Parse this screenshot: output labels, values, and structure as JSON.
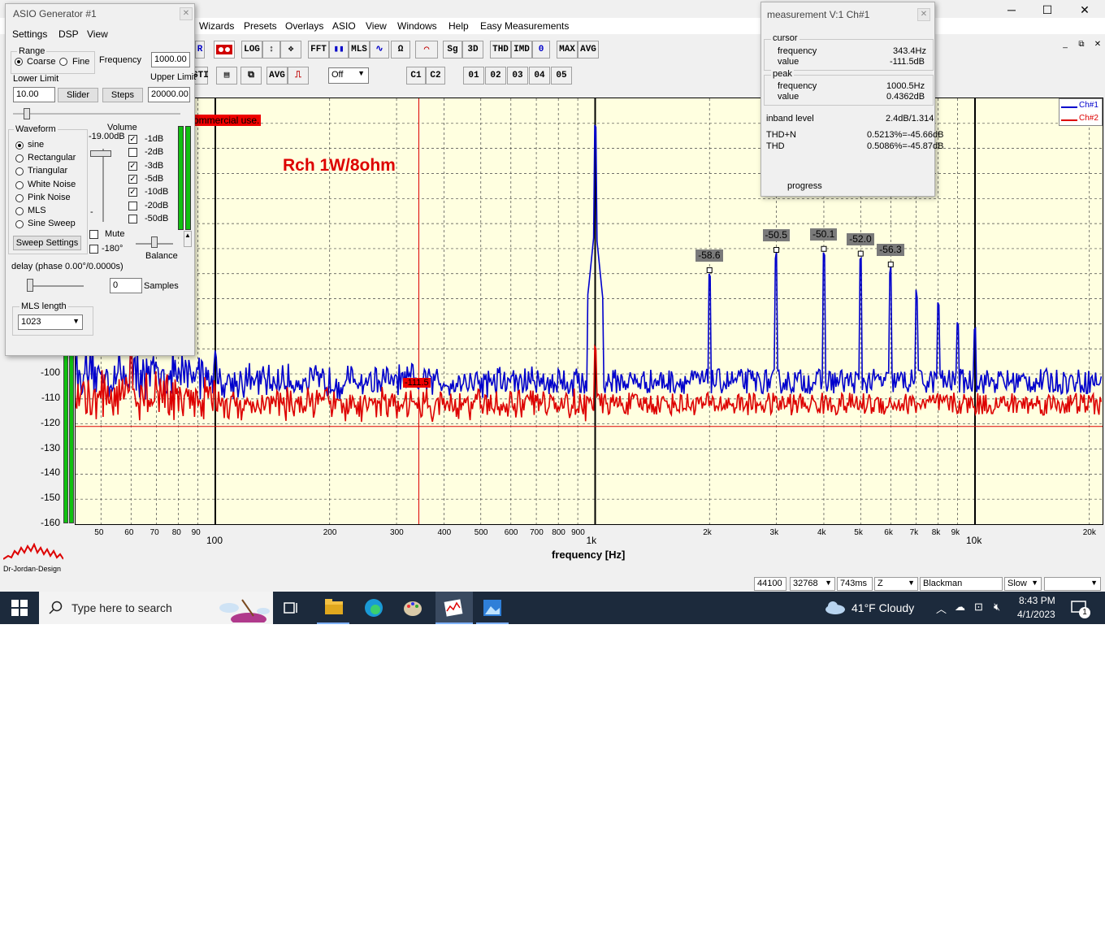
{
  "menu": [
    "Wizards",
    "Presets",
    "Overlays",
    "ASIO",
    "View",
    "Windows",
    "Help",
    "Easy Measurements"
  ],
  "window_controls": {
    "minimize": "─",
    "maximize": "☐",
    "close": "✕"
  },
  "toolbar": {
    "row1": [
      "R",
      "LOG",
      "↕",
      "✥",
      "FFT",
      "▮▮",
      "MLS",
      "∿",
      "Ω",
      "⌒",
      "Sg",
      "3D",
      "THD",
      "IMD",
      "0",
      "MAX",
      "AVG"
    ],
    "row2": [
      "STI",
      "▤",
      "⧉",
      "AVG",
      "⎍",
      "C1",
      "C2",
      "01",
      "02",
      "03",
      "04",
      "05"
    ],
    "dropdown_off": "Off"
  },
  "asio": {
    "title": "ASIO Generator #1",
    "menu": [
      "Settings",
      "DSP",
      "View"
    ],
    "range_label": "Range",
    "coarse": "Coarse",
    "fine": "Fine",
    "frequency_label": "Frequency",
    "frequency_value": "1000.00",
    "lower_limit_label": "Lower Limit",
    "lower_limit_value": "10.00",
    "upper_limit_label": "Upper Limit",
    "upper_limit_value": "20000.00",
    "slider_btn": "Slider",
    "steps_btn": "Steps",
    "waveform_label": "Waveform",
    "waveforms": [
      "sine",
      "Rectangular",
      "Triangular",
      "White Noise",
      "Pink Noise",
      "MLS",
      "Sine Sweep"
    ],
    "sweep_settings": "Sweep Settings",
    "volume_label": "Volume",
    "volume_value": "-19.00dB",
    "volume_steps": [
      "-1dB",
      "-2dB",
      "-3dB",
      "-5dB",
      "-10dB",
      "-20dB",
      "-50dB"
    ],
    "volume_checked": [
      true,
      false,
      true,
      true,
      true,
      false,
      false
    ],
    "mute": "Mute",
    "phase180": "-180°",
    "balance": "Balance",
    "delay_label": "delay (phase  0.00°/0.0000s)",
    "samples_value": "0",
    "samples_label": "Samples",
    "mls_length_label": "MLS length",
    "mls_length_value": "1023"
  },
  "measurement": {
    "title": "measurement V:1 Ch#1",
    "cursor_label": "cursor",
    "cursor_freq_label": "frequency",
    "cursor_freq": "343.4Hz",
    "cursor_value_label": "value",
    "cursor_value": "-111.5dB",
    "peak_label": "peak",
    "peak_freq_label": "frequency",
    "peak_freq": "1000.5Hz",
    "peak_value_label": "value",
    "peak_value": "0.4362dB",
    "inband_label": "inband level",
    "inband_value": "2.4dB/1.314",
    "thdn_label": "THD+N",
    "thdn_value": "0.5213%=-45.66dB",
    "thd_label": "THD",
    "thd_value": "0.5086%=-45.87dB",
    "progress_label": "progress"
  },
  "chart_annotation": "Rch 1W/8ohm",
  "watermark": "ommercial use.",
  "cursor_label_value": "-111.5",
  "logo_text": "Dr-Jordan-Design",
  "chart_data": {
    "type": "line",
    "xlabel": "frequency [Hz]",
    "x_scale": "log",
    "xlim": [
      40,
      22000
    ],
    "ylim": [
      -160,
      10
    ],
    "y_tick_labels": [
      "-100",
      "-110",
      "-120",
      "-130",
      "-140",
      "-150",
      "-160"
    ],
    "x_tick_labels": [
      "50",
      "60",
      "70",
      "80",
      "90",
      "100",
      "200",
      "300",
      "400",
      "500",
      "600",
      "700",
      "800",
      "900",
      "1k",
      "2k",
      "3k",
      "4k",
      "5k",
      "6k",
      "7k",
      "8k",
      "9k",
      "10k",
      "20k"
    ],
    "legend": [
      "Ch#1",
      "Ch#2"
    ],
    "legend_position": "top-right",
    "series_colors": {
      "Ch#1": "#0000cc",
      "Ch#2": "#dd0000"
    },
    "cursor_hz": 343.4,
    "series": [
      {
        "name": "Ch#1",
        "peaks": [
          {
            "x": 1000,
            "y": 0.4
          },
          {
            "x": 2000,
            "y": -58.6
          },
          {
            "x": 3000,
            "y": -50.5
          },
          {
            "x": 4000,
            "y": -50.1
          },
          {
            "x": 5000,
            "y": -52.0
          },
          {
            "x": 6000,
            "y": -56.3
          },
          {
            "x": 7000,
            "y": -66
          },
          {
            "x": 8000,
            "y": -70
          },
          {
            "x": 9000,
            "y": -78
          },
          {
            "x": 10000,
            "y": -80
          },
          {
            "x": 100,
            "y": -90
          },
          {
            "x": 60,
            "y": -86
          }
        ],
        "noise_floor": -103
      },
      {
        "name": "Ch#2",
        "peaks": [
          {
            "x": 1000,
            "y": -88
          },
          {
            "x": 60,
            "y": -88
          }
        ],
        "noise_floor": -112
      }
    ],
    "harmonic_labels": [
      "-58.6",
      "-50.5",
      "-50.1",
      "-52.0",
      "-56.3"
    ]
  },
  "status_bar": [
    "44100",
    "32768",
    "743ms",
    "Z",
    "Blackman",
    "Slow",
    ""
  ],
  "taskbar": {
    "search_placeholder": "Type here to search",
    "weather": "41°F  Cloudy",
    "time": "8:43 PM",
    "date": "4/1/2023",
    "notifications": "1"
  }
}
